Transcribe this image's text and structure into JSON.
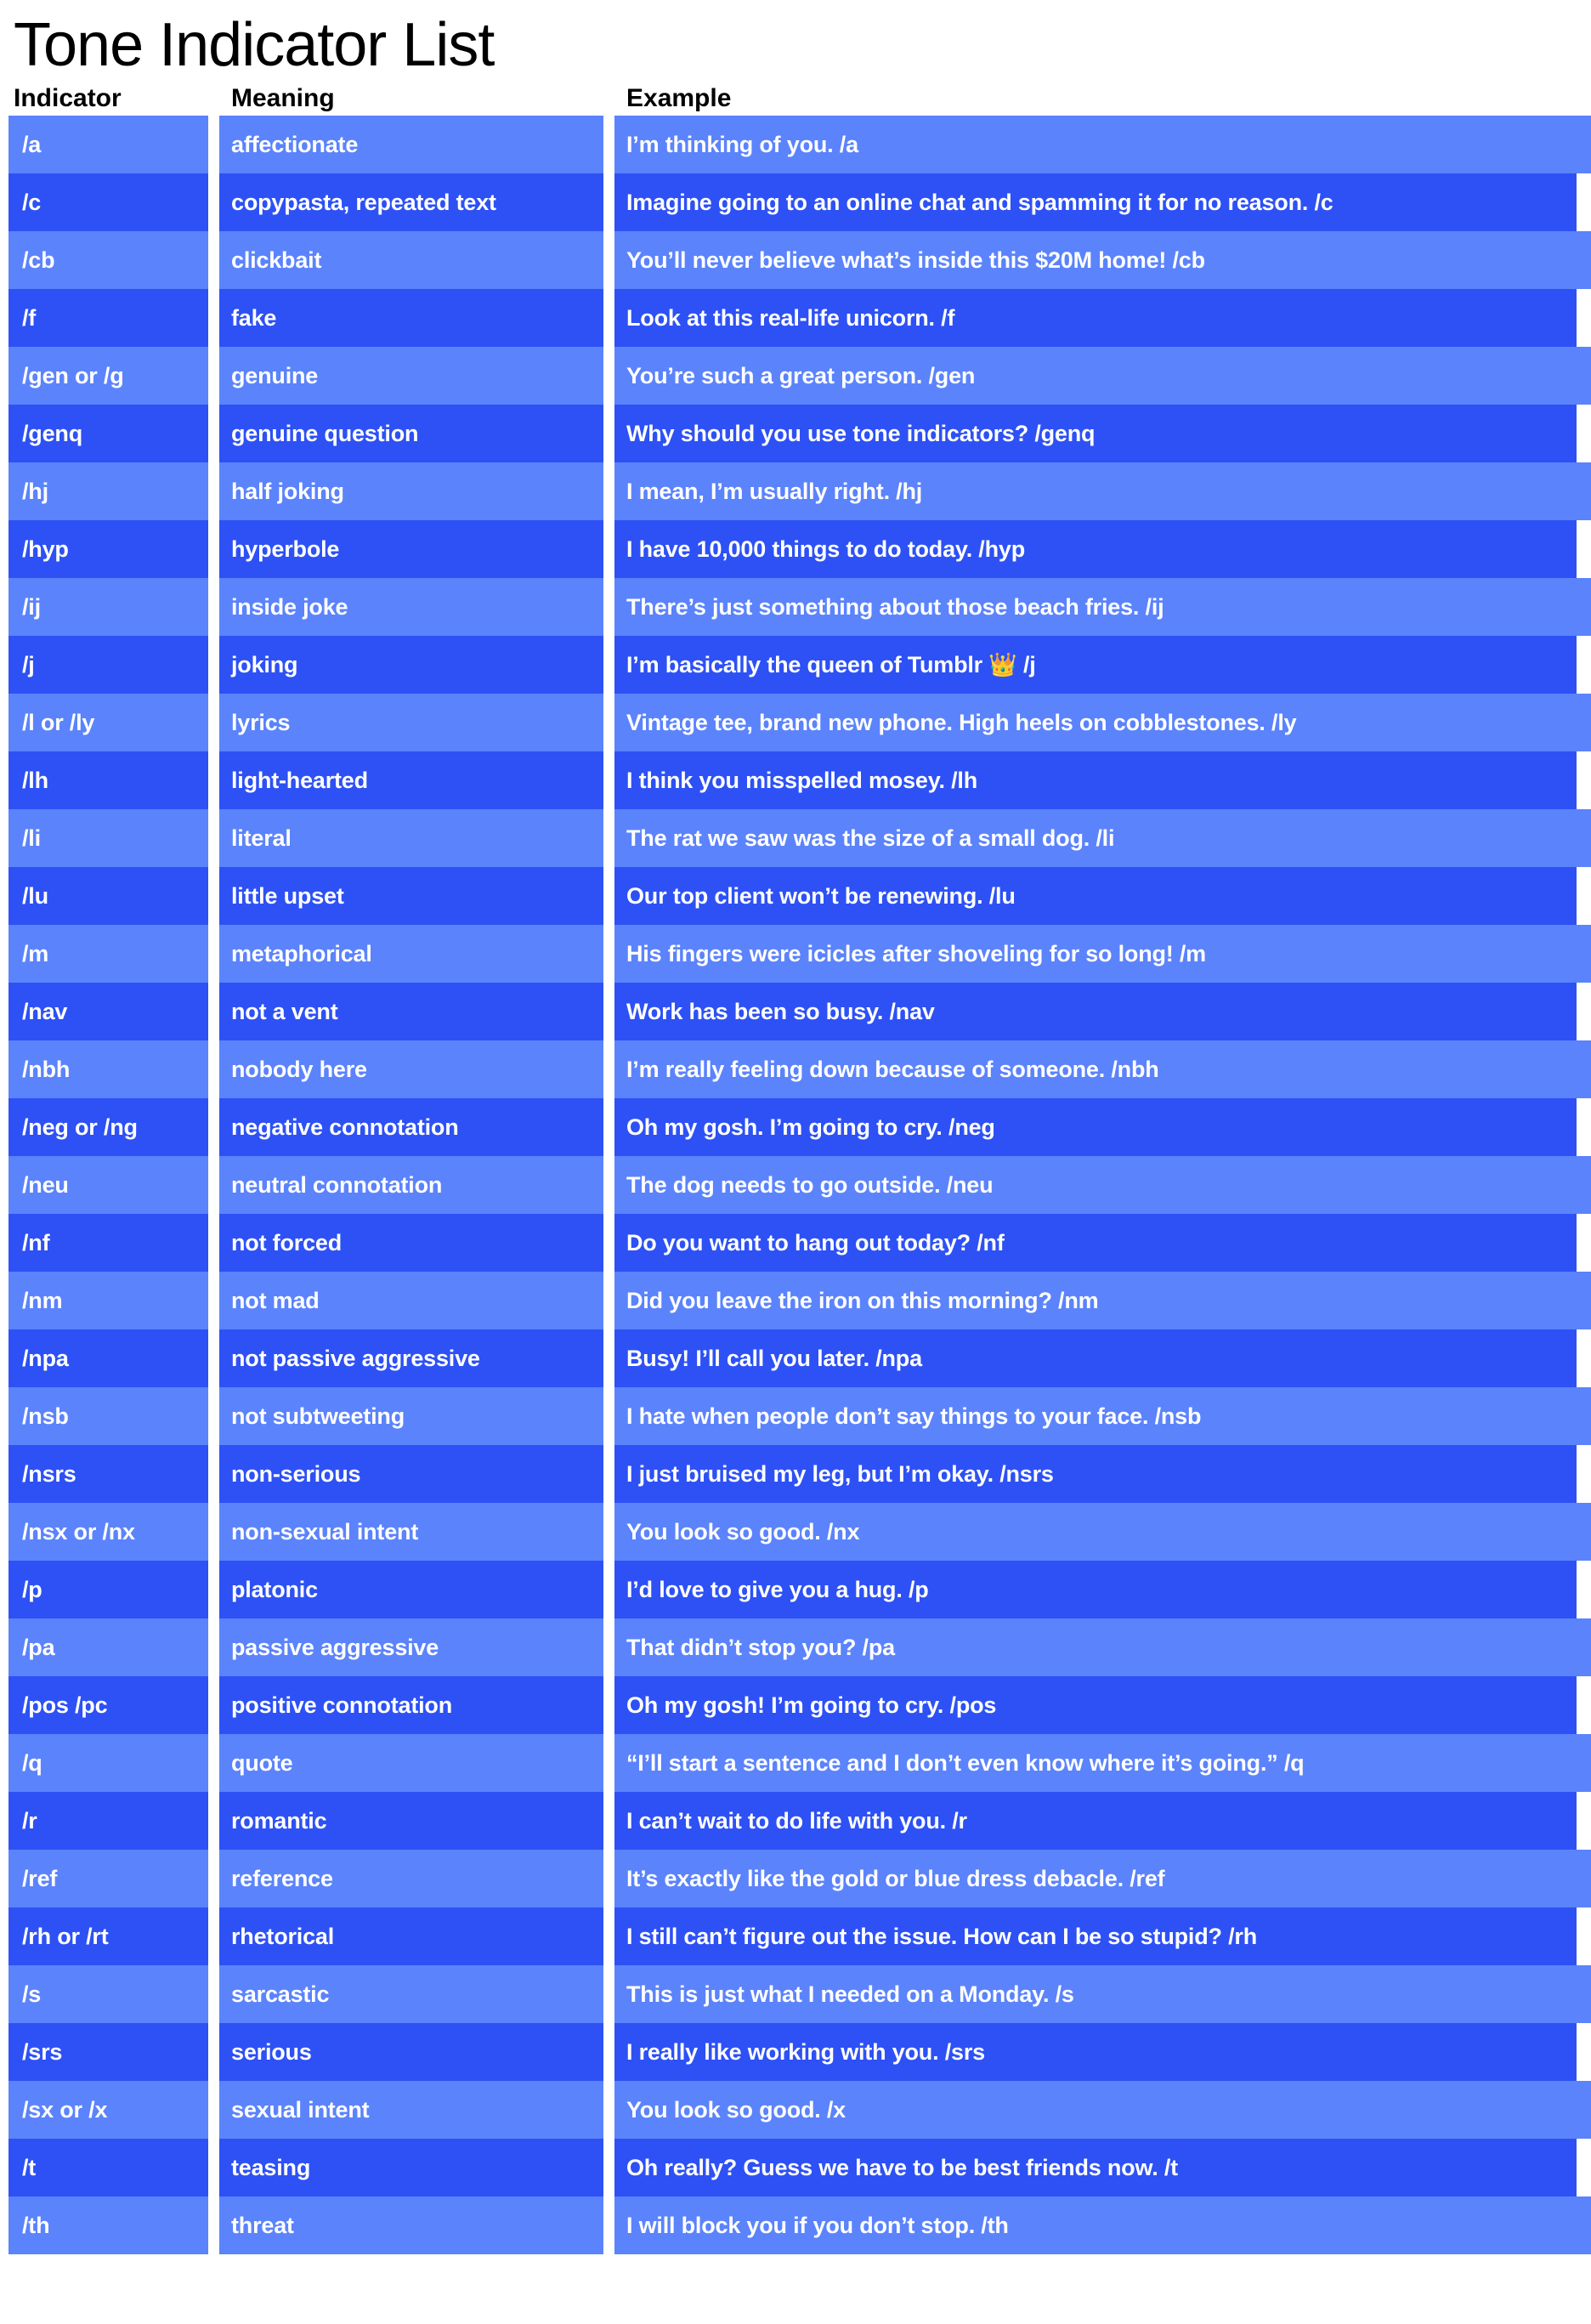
{
  "title": "Tone Indicator List",
  "colors": {
    "band_light": "#5b83fc",
    "band_dark": "#2d51f5",
    "text_on_band": "#ffffff",
    "header_text": "#000000",
    "page_background": "#ffffff"
  },
  "columns": {
    "indicator": "Indicator",
    "meaning": "Meaning",
    "example": "Example"
  },
  "rows": [
    {
      "indicator": "/a",
      "meaning": "affectionate",
      "example": "I’m thinking of you. /a"
    },
    {
      "indicator": "/c",
      "meaning": "copypasta, repeated text",
      "example": "Imagine going to an online chat and spamming it for no reason. /c"
    },
    {
      "indicator": "/cb",
      "meaning": "clickbait",
      "example": "You’ll never believe what’s inside this $20M home! /cb"
    },
    {
      "indicator": "/f",
      "meaning": "fake",
      "example": "Look at this real-life unicorn. /f"
    },
    {
      "indicator": "/gen or /g",
      "meaning": "genuine",
      "example": "You’re such a great person. /gen"
    },
    {
      "indicator": "/genq",
      "meaning": "genuine question",
      "example": "Why should you use tone indicators? /genq"
    },
    {
      "indicator": "/hj",
      "meaning": "half joking",
      "example": "I mean, I’m usually right. /hj"
    },
    {
      "indicator": "/hyp",
      "meaning": "hyperbole",
      "example": "I have 10,000 things to do today. /hyp"
    },
    {
      "indicator": "/ij",
      "meaning": "inside joke",
      "example": "There’s just something about those beach fries. /ij"
    },
    {
      "indicator": "/j",
      "meaning": "joking",
      "example": "I’m basically the queen of Tumblr 👑 /j"
    },
    {
      "indicator": "/l or /ly",
      "meaning": "lyrics",
      "example": "Vintage tee, brand new phone. High heels on cobblestones. /ly"
    },
    {
      "indicator": "/lh",
      "meaning": "light-hearted",
      "example": "I think you misspelled mosey. /lh"
    },
    {
      "indicator": "/li",
      "meaning": "literal",
      "example": "The rat we saw was the size of a small dog. /li"
    },
    {
      "indicator": "/lu",
      "meaning": "little upset",
      "example": "Our top client won’t be renewing. /lu"
    },
    {
      "indicator": "/m",
      "meaning": "metaphorical",
      "example": "His fingers were icicles after shoveling for so long! /m"
    },
    {
      "indicator": "/nav",
      "meaning": "not a vent",
      "example": "Work has been so busy. /nav"
    },
    {
      "indicator": "/nbh",
      "meaning": "nobody here",
      "example": "I’m really feeling down because of someone. /nbh"
    },
    {
      "indicator": "/neg or /ng",
      "meaning": "negative connotation",
      "example": "Oh my gosh. I’m going to cry.  /neg"
    },
    {
      "indicator": "/neu",
      "meaning": "neutral connotation",
      "example": "The dog needs to go outside. /neu"
    },
    {
      "indicator": "/nf",
      "meaning": "not forced",
      "example": "Do you want to hang out today? /nf"
    },
    {
      "indicator": "/nm",
      "meaning": "not mad",
      "example": "Did you leave the iron on this morning? /nm"
    },
    {
      "indicator": "/npa",
      "meaning": "not passive aggressive",
      "example": "Busy! I’ll call you later. /npa"
    },
    {
      "indicator": "/nsb",
      "meaning": "not subtweeting",
      "example": "I hate when people don’t say things to your face. /nsb"
    },
    {
      "indicator": "/nsrs",
      "meaning": "non-serious",
      "example": "I just bruised my leg, but I’m okay. /nsrs"
    },
    {
      "indicator": "/nsx or /nx",
      "meaning": "non-sexual intent",
      "example": "You look so good. /nx"
    },
    {
      "indicator": "/p",
      "meaning": "platonic",
      "example": "I’d love to give you a hug. /p"
    },
    {
      "indicator": "/pa",
      "meaning": "passive aggressive",
      "example": "That didn’t stop you? /pa"
    },
    {
      "indicator": "/pos /pc",
      "meaning": "positive connotation",
      "example": "Oh my gosh! I’m going to cry.  /pos"
    },
    {
      "indicator": "/q",
      "meaning": "quote",
      "example": "“I’ll start a sentence and I don’t even know where it’s going.” /q"
    },
    {
      "indicator": "/r",
      "meaning": "romantic",
      "example": "I can’t wait to do life with you. /r"
    },
    {
      "indicator": "/ref",
      "meaning": "reference",
      "example": "It’s exactly like the gold or blue dress debacle. /ref"
    },
    {
      "indicator": "/rh or /rt",
      "meaning": "rhetorical",
      "example": "I still can’t figure out the issue. How can I be so stupid? /rh"
    },
    {
      "indicator": "/s",
      "meaning": "sarcastic",
      "example": "This is just what I needed on a Monday. /s"
    },
    {
      "indicator": "/srs",
      "meaning": "serious",
      "example": "I really like working with you. /srs"
    },
    {
      "indicator": "/sx or /x",
      "meaning": "sexual intent",
      "example": "You look so good. /x"
    },
    {
      "indicator": "/t",
      "meaning": "teasing",
      "example": "Oh really? Guess we have to be best friends now. /t"
    },
    {
      "indicator": "/th",
      "meaning": "threat",
      "example": "I will block you if you don’t stop. /th"
    }
  ]
}
